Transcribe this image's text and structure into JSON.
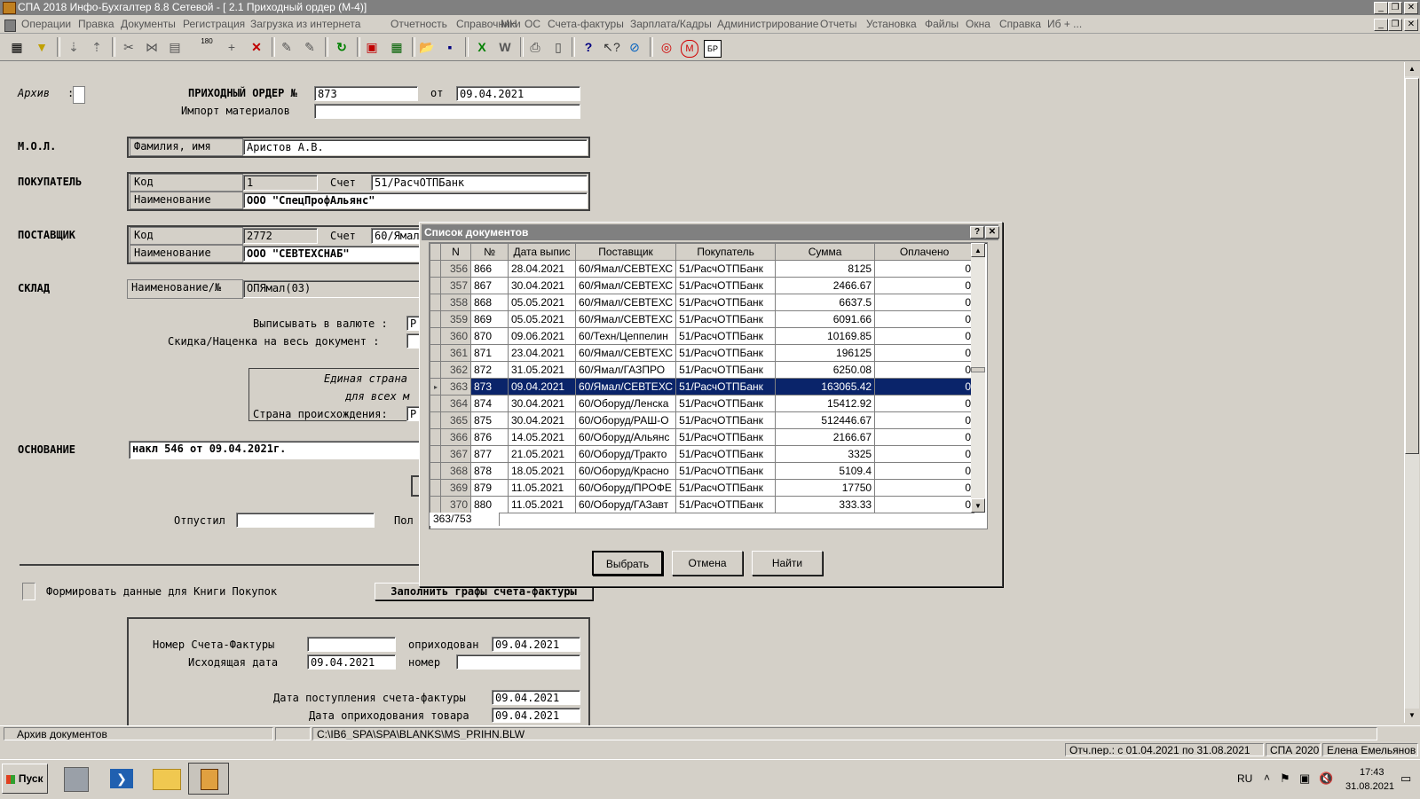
{
  "window": {
    "title": "СПА 2018 Инфо-Бухгалтер 8.8 Сетевой - [ 2.1 Приходный ордер (М-4)]"
  },
  "menu": [
    "Операции",
    "Правка",
    "Документы",
    "Регистрация",
    "Загрузка из интернета",
    "Отчетность",
    "Справочники",
    "МН",
    "ОС",
    "Счета-фактуры",
    "Зарплата/Кадры",
    "Администрирование",
    "Отчеты",
    "Установка",
    "Файлы",
    "Окна",
    "Справка",
    "Иб + ..."
  ],
  "toolbar": {
    "icons": [
      "list-icon",
      "filter-icon",
      "sort-asc-icon",
      "sort-desc-icon",
      "cut-icon",
      "merge-icon",
      "paste-icon",
      "calculator-icon",
      "add-icon",
      "delete-icon",
      "edit-icon",
      "edit-multi-icon",
      "refresh-icon",
      "calendar-icon",
      "spreadsheet-icon",
      "open-folder-icon",
      "save-icon",
      "excel-icon",
      "word-icon",
      "print-icon",
      "preview-icon",
      "help-icon",
      "context-help-icon",
      "compass-icon",
      "lifebuoy-icon",
      "m-icon",
      "br-icon"
    ],
    "br_label": "БР",
    "m_label": "М",
    "calc_label": "180"
  },
  "form": {
    "archive_label": "Архив",
    "archive_colon": ":",
    "order_label": "ПРИХОДНЫЙ ОРДЕР №",
    "order_number": "873",
    "from_label": "от",
    "order_date": "09.04.2021",
    "import_label": "Импорт материалов",
    "import_value": "",
    "mol_label": "М.О.Л.",
    "mol_field_label": "Фамилия, имя",
    "mol_value": "Аристов А.В.",
    "buyer_label": "ПОКУПАТЕЛЬ",
    "buyer_code_label": "Код",
    "buyer_code": "1",
    "buyer_account_label": "Счет",
    "buyer_account": "51/РасчОТПБанк",
    "buyer_name_label": "Наименование",
    "buyer_name": "ООО \"СпецПрофАльянс\"",
    "supplier_label": "ПОСТАВЩИК",
    "supplier_code_label": "Код",
    "supplier_code": "2772",
    "supplier_account_label": "Счет",
    "supplier_account": "60/Ямал",
    "supplier_name_label": "Наименование",
    "supplier_name": "ООО \"СЕВТЕХСНАБ\"",
    "warehouse_label": "СКЛАД",
    "warehouse_field_label": "Наименование/№",
    "warehouse_value": "ОПЯмал(03)",
    "currency_label": "Выписывать в валюте :",
    "currency_value": "Р",
    "discount_label": "Скидка/Наценка на весь документ :",
    "discount_value": "",
    "country_line1": "Единая страна",
    "country_line2": "для всех м",
    "country_origin_label": "Страна происхождения:",
    "country_origin_value": "Р",
    "basis_label": "ОСНОВАНИЕ",
    "basis_value": "накл 546     от     09.04.2021г.",
    "released_label": "Отпустил",
    "released_value": "",
    "received_label": "Пол",
    "purchase_book_label": "Формировать данные для Книги Покупок",
    "fill_invoice_button": "Заполнить графы счета-фактуры",
    "invoice_number_label": "Номер Счета-Фактуры",
    "invoice_number": "",
    "received_on_label": "оприходован",
    "received_on": "09.04.2021",
    "outgoing_date_label": "Исходящая дата",
    "outgoing_date": "09.04.2021",
    "number_label": "номер",
    "number_value": "",
    "invoice_arrival_label": "Дата поступления счета-фактуры",
    "invoice_arrival": "09.04.2021",
    "goods_received_label": "Дата оприходования товара",
    "goods_received": "09.04.2021"
  },
  "dialog": {
    "title": "Список документов",
    "help_btn": "?",
    "close_btn": "✕",
    "columns": [
      "N",
      "№",
      "Дата выпис",
      "Поставщик",
      "Покупатель",
      "Сумма",
      "Оплачено"
    ],
    "rows": [
      [
        "356",
        "866",
        "28.04.2021",
        "60/Ямал/СЕВТЕХС",
        "51/РасчОТПБанк",
        "8125",
        "0"
      ],
      [
        "357",
        "867",
        "30.04.2021",
        "60/Ямал/СЕВТЕХС",
        "51/РасчОТПБанк",
        "2466.67",
        "0"
      ],
      [
        "358",
        "868",
        "05.05.2021",
        "60/Ямал/СЕВТЕХС",
        "51/РасчОТПБанк",
        "6637.5",
        "0"
      ],
      [
        "359",
        "869",
        "05.05.2021",
        "60/Ямал/СЕВТЕХС",
        "51/РасчОТПБанк",
        "6091.66",
        "0"
      ],
      [
        "360",
        "870",
        "09.06.2021",
        "60/Техн/Цеппелин",
        "51/РасчОТПБанк",
        "10169.85",
        "0"
      ],
      [
        "361",
        "871",
        "23.04.2021",
        "60/Ямал/СЕВТЕХС",
        "51/РасчОТПБанк",
        "196125",
        "0"
      ],
      [
        "362",
        "872",
        "31.05.2021",
        "60/Ямал/ГАЗПРО",
        "51/РасчОТПБанк",
        "6250.08",
        "0"
      ],
      [
        "363",
        "873",
        "09.04.2021",
        "60/Ямал/СЕВТЕХС",
        "51/РасчОТПБанк",
        "163065.42",
        "0"
      ],
      [
        "364",
        "874",
        "30.04.2021",
        "60/Оборуд/Ленска",
        "51/РасчОТПБанк",
        "15412.92",
        "0"
      ],
      [
        "365",
        "875",
        "30.04.2021",
        "60/Оборуд/РАШ-О",
        "51/РасчОТПБанк",
        "512446.67",
        "0"
      ],
      [
        "366",
        "876",
        "14.05.2021",
        "60/Оборуд/Альянс",
        "51/РасчОТПБанк",
        "2166.67",
        "0"
      ],
      [
        "367",
        "877",
        "21.05.2021",
        "60/Оборуд/Тракто",
        "51/РасчОТПБанк",
        "3325",
        "0"
      ],
      [
        "368",
        "878",
        "18.05.2021",
        "60/Оборуд/Красно",
        "51/РасчОТПБанк",
        "5109.4",
        "0"
      ],
      [
        "369",
        "879",
        "11.05.2021",
        "60/Оборуд/ПРОФЕ",
        "51/РасчОТПБанк",
        "17750",
        "0"
      ],
      [
        "370",
        "880",
        "11.05.2021",
        "60/Оборуд/ГАЗавт",
        "51/РасчОТПБанк",
        "333.33",
        "0"
      ]
    ],
    "selected_row": 7,
    "counter": "363/753",
    "buttons": {
      "select": "Выбрать",
      "cancel": "Отмена",
      "find": "Найти"
    }
  },
  "statusbar": {
    "left": "Архив документов",
    "path": "C:\\IB6_SPA\\SPA\\BLANKS\\MS_PRIHN.BLW",
    "period": "Отч.пер.: с 01.04.2021 по 31.08.2021",
    "product": "СПА 2020",
    "user": "Елена Емельянов"
  },
  "taskbar": {
    "start": "Пуск",
    "lang": "RU",
    "time": "17:43",
    "date": "31.08.2021"
  },
  "colors": {
    "selection": "#0a246a",
    "face": "#d4d0c8",
    "titlebar": "#808080"
  }
}
